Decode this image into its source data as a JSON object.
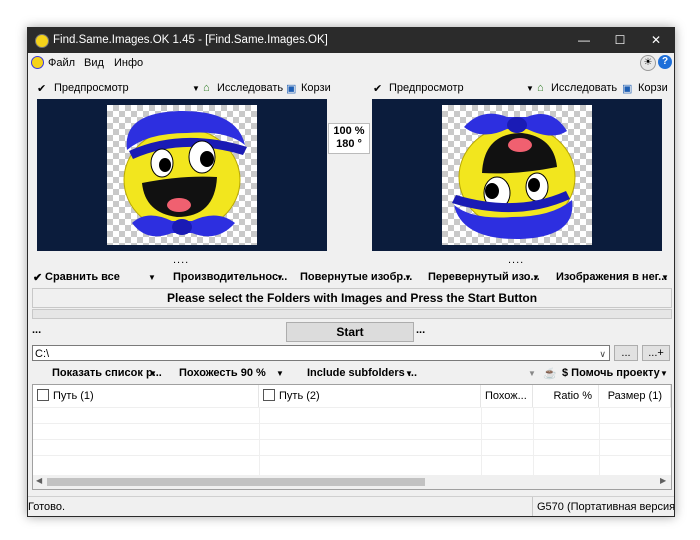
{
  "window": {
    "title": "Find.Same.Images.OK 1.45 - [Find.Same.Images.OK]",
    "min_icon": "minimize-icon",
    "max_icon": "maximize-icon",
    "close_icon": "close-icon"
  },
  "menu": {
    "items": [
      "Файл",
      "Вид",
      "Инфо"
    ]
  },
  "left_toolbar": {
    "preview_label": "Предпросмотр",
    "explore_label": "Исследовать",
    "recycle_label": "Корзи"
  },
  "right_toolbar": {
    "preview_label": "Предпросмотр",
    "explore_label": "Исследовать",
    "recycle_label": "Корзи"
  },
  "zoom": {
    "percent": "100 %",
    "angle": "180 °"
  },
  "dots": "....",
  "compare_bar": {
    "compare_all": "Сравнить все",
    "performance": "Производительнос...",
    "rotated": "Повернутые изобр...",
    "flipped": "Перевернутый изо...",
    "images_in": "Изображения в нег..."
  },
  "status_message": "Please select the Folders with Images and Press the Start Button",
  "progress": {
    "value": 0
  },
  "start_button": "Start",
  "side_dots_left": "...",
  "side_dots_right": "...",
  "path": {
    "value": "C:\\"
  },
  "browse_button": "...",
  "add_button": "...+",
  "options_bar": {
    "show_list": "Показать список р...",
    "similarity": "Похожесть 90 %",
    "subfolders": "Include subfolders ...",
    "support": "$ Помочь проекту"
  },
  "table": {
    "columns": [
      "Путь (1)",
      "Путь (2)",
      "Похож...",
      "Ratio %",
      "Размер (1)"
    ]
  },
  "status": {
    "left": "Готово.",
    "right": "G570 (Портативная версия/x"
  },
  "colors": {
    "preview_bg": "#0b1c3c",
    "titlebar": "#2b2b2b"
  }
}
